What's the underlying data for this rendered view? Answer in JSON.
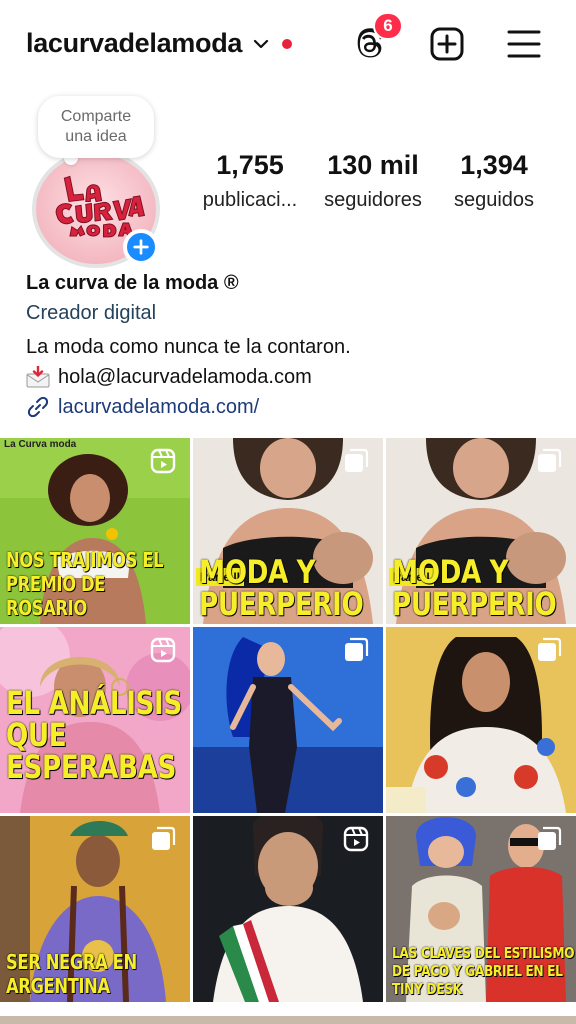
{
  "header": {
    "username": "lacurvadelamoda",
    "threads_badge": "6"
  },
  "note": {
    "line1": "Comparte",
    "line2": "una idea"
  },
  "avatar": {
    "logo_text": "La Curva de la moda"
  },
  "stats": {
    "posts": {
      "value": "1,755",
      "label": "publicaci..."
    },
    "followers": {
      "value": "130 mil",
      "label": "seguidores"
    },
    "following": {
      "value": "1,394",
      "label": "seguidos"
    }
  },
  "bio": {
    "name": "La curva de la moda ®",
    "category": "Creador digital",
    "description": "La moda como nunca te la contaron.",
    "email": "hola@lacurvadelamoda.com",
    "link": "lacurvadelamoda.com/"
  },
  "grid": {
    "tiles": [
      {
        "caption": "NOS TRAJIMOS EL PREMIO DE ROSARIO",
        "part": "",
        "type": "reel",
        "brand": "La Curva moda"
      },
      {
        "caption": "MODA Y PUERPERIO",
        "part": "Parte II",
        "type": "carousel",
        "brand": ""
      },
      {
        "caption": "MODA Y PUERPERIO",
        "part": "Parte I",
        "type": "carousel",
        "brand": ""
      },
      {
        "caption": "EL ANÁLISIS QUE ESPERABAS",
        "part": "",
        "type": "reel",
        "brand": ""
      },
      {
        "caption": "",
        "part": "",
        "type": "carousel",
        "brand": ""
      },
      {
        "caption": "",
        "part": "",
        "type": "carousel",
        "brand": ""
      },
      {
        "caption": "SER NEGRA EN ARGENTINA",
        "part": "",
        "type": "carousel",
        "brand": ""
      },
      {
        "caption": "",
        "part": "",
        "type": "reel",
        "brand": ""
      },
      {
        "caption": "LAS CLAVES DEL ESTILISMO DE PACO Y GABRIEL EN EL TINY DESK",
        "part": "",
        "type": "carousel",
        "brand": ""
      }
    ]
  },
  "colors": {
    "accent_blue": "#1a8cff",
    "badge_red": "#ff2d4a",
    "caption_yellow": "#f7ee2a",
    "category_text": "#24425a",
    "link_text": "#1d3a7a"
  }
}
